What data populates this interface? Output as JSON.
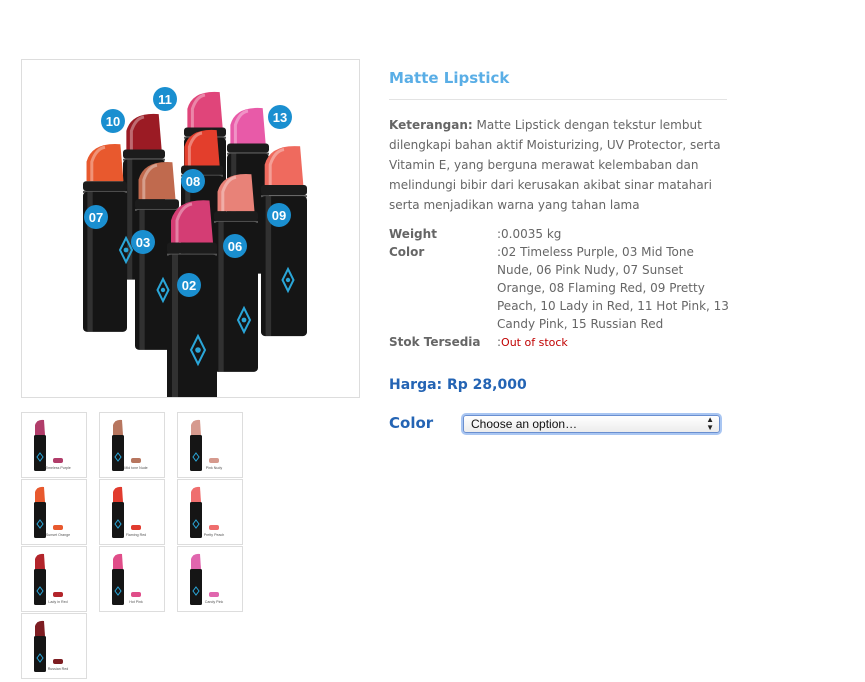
{
  "product": {
    "title": "Matte Lipstick",
    "description_label": "Keterangan:",
    "description": " Matte Lipstick dengan tekstur lembut dilengkapi bahan aktif Moisturizing, UV Protector, serta Vitamin E, yang berguna merawat kelembaban dan melindungi bibir dari kerusakan akibat sinar matahari serta menjadikan warna yang tahan lama",
    "specs": [
      {
        "label": "Weight",
        "value": ":0.0035 kg"
      },
      {
        "label": "Color",
        "value": ":02 Timeless Purple, 03 Mid Tone Nude, 06 Pink Nudy, 07 Sunset Orange, 08 Flaming Red, 09 Pretty Peach, 10 Lady in Red, 11 Hot Pink, 13 Candy Pink, 15 Russian Red"
      },
      {
        "label": "Stok Tersedia",
        "value": ":",
        "status": "Out of stock"
      }
    ],
    "price": "Harga: Rp 28,000",
    "color_label": "Color",
    "color_select": {
      "selected": "Choose an option…"
    }
  },
  "main_image": {
    "numbers": [
      "10",
      "11",
      "13",
      "07",
      "03",
      "08",
      "09",
      "06",
      "02"
    ],
    "colors": {
      "10": "#9b1b24",
      "11": "#e0457a",
      "13": "#e85aa8",
      "07": "#e8592e",
      "03": "#c06a4e",
      "08": "#e33e2c",
      "09": "#ef6a5e",
      "06": "#e88278",
      "02": "#d43d74"
    }
  },
  "thumbnails": [
    {
      "color": "#b13d6a",
      "label": "Timeless Purple"
    },
    {
      "color": "#b7765f",
      "label": "Mid tone Nude"
    },
    {
      "color": "#d69a8e",
      "label": "Pink Nudy"
    },
    {
      "color": "#e8592e",
      "label": "Sunset Orange"
    },
    {
      "color": "#e13b2e",
      "label": "Flaming Red"
    },
    {
      "color": "#ef6e6e",
      "label": "Pretty Peach"
    },
    {
      "color": "#b3252b",
      "label": "Lady in Red"
    },
    {
      "color": "#e04d89",
      "label": "Hot Pink"
    },
    {
      "color": "#e066ae",
      "label": "Candy Pink"
    },
    {
      "color": "#7d1d22",
      "label": "Russian Red"
    }
  ]
}
